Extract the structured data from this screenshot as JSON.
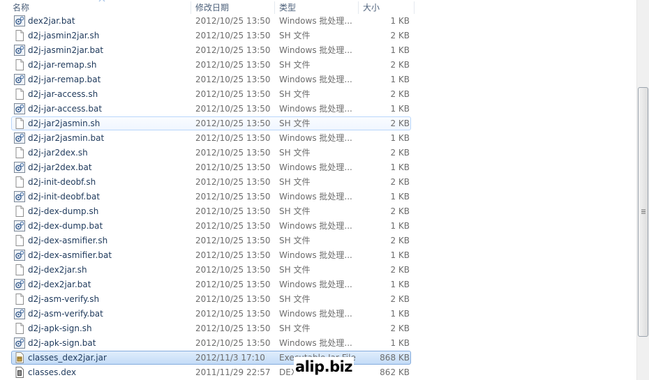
{
  "columns": {
    "name": "名称",
    "date": "修改日期",
    "type": "类型",
    "size": "大小"
  },
  "files": [
    {
      "name": "dex2jar.bat",
      "date": "2012/10/25 13:50",
      "type": "Windows 批处理...",
      "size": "1 KB",
      "icon": "batch-file-icon"
    },
    {
      "name": "d2j-jasmin2jar.sh",
      "date": "2012/10/25 13:50",
      "type": "SH 文件",
      "size": "2 KB",
      "icon": "blank-file-icon"
    },
    {
      "name": "d2j-jasmin2jar.bat",
      "date": "2012/10/25 13:50",
      "type": "Windows 批处理...",
      "size": "1 KB",
      "icon": "batch-file-icon"
    },
    {
      "name": "d2j-jar-remap.sh",
      "date": "2012/10/25 13:50",
      "type": "SH 文件",
      "size": "2 KB",
      "icon": "blank-file-icon"
    },
    {
      "name": "d2j-jar-remap.bat",
      "date": "2012/10/25 13:50",
      "type": "Windows 批处理...",
      "size": "1 KB",
      "icon": "batch-file-icon"
    },
    {
      "name": "d2j-jar-access.sh",
      "date": "2012/10/25 13:50",
      "type": "SH 文件",
      "size": "2 KB",
      "icon": "blank-file-icon"
    },
    {
      "name": "d2j-jar-access.bat",
      "date": "2012/10/25 13:50",
      "type": "Windows 批处理...",
      "size": "1 KB",
      "icon": "batch-file-icon"
    },
    {
      "name": "d2j-jar2jasmin.sh",
      "date": "2012/10/25 13:50",
      "type": "SH 文件",
      "size": "2 KB",
      "icon": "blank-file-icon",
      "state": "hover"
    },
    {
      "name": "d2j-jar2jasmin.bat",
      "date": "2012/10/25 13:50",
      "type": "Windows 批处理...",
      "size": "1 KB",
      "icon": "batch-file-icon"
    },
    {
      "name": "d2j-jar2dex.sh",
      "date": "2012/10/25 13:50",
      "type": "SH 文件",
      "size": "2 KB",
      "icon": "blank-file-icon"
    },
    {
      "name": "d2j-jar2dex.bat",
      "date": "2012/10/25 13:50",
      "type": "Windows 批处理...",
      "size": "1 KB",
      "icon": "batch-file-icon"
    },
    {
      "name": "d2j-init-deobf.sh",
      "date": "2012/10/25 13:50",
      "type": "SH 文件",
      "size": "2 KB",
      "icon": "blank-file-icon"
    },
    {
      "name": "d2j-init-deobf.bat",
      "date": "2012/10/25 13:50",
      "type": "Windows 批处理...",
      "size": "1 KB",
      "icon": "batch-file-icon"
    },
    {
      "name": "d2j-dex-dump.sh",
      "date": "2012/10/25 13:50",
      "type": "SH 文件",
      "size": "2 KB",
      "icon": "blank-file-icon"
    },
    {
      "name": "d2j-dex-dump.bat",
      "date": "2012/10/25 13:50",
      "type": "Windows 批处理...",
      "size": "1 KB",
      "icon": "batch-file-icon"
    },
    {
      "name": "d2j-dex-asmifier.sh",
      "date": "2012/10/25 13:50",
      "type": "SH 文件",
      "size": "2 KB",
      "icon": "blank-file-icon"
    },
    {
      "name": "d2j-dex-asmifier.bat",
      "date": "2012/10/25 13:50",
      "type": "Windows 批处理...",
      "size": "1 KB",
      "icon": "batch-file-icon"
    },
    {
      "name": "d2j-dex2jar.sh",
      "date": "2012/10/25 13:50",
      "type": "SH 文件",
      "size": "2 KB",
      "icon": "blank-file-icon"
    },
    {
      "name": "d2j-dex2jar.bat",
      "date": "2012/10/25 13:50",
      "type": "Windows 批处理...",
      "size": "1 KB",
      "icon": "batch-file-icon"
    },
    {
      "name": "d2j-asm-verify.sh",
      "date": "2012/10/25 13:50",
      "type": "SH 文件",
      "size": "2 KB",
      "icon": "blank-file-icon"
    },
    {
      "name": "d2j-asm-verify.bat",
      "date": "2012/10/25 13:50",
      "type": "Windows 批处理...",
      "size": "1 KB",
      "icon": "batch-file-icon"
    },
    {
      "name": "d2j-apk-sign.sh",
      "date": "2012/10/25 13:50",
      "type": "SH 文件",
      "size": "2 KB",
      "icon": "blank-file-icon"
    },
    {
      "name": "d2j-apk-sign.bat",
      "date": "2012/10/25 13:50",
      "type": "Windows 批处理...",
      "size": "1 KB",
      "icon": "batch-file-icon"
    },
    {
      "name": "classes_dex2jar.jar",
      "date": "2012/11/3 17:10",
      "type": "Executable Jar File",
      "size": "868 KB",
      "icon": "jar-file-icon",
      "state": "selected"
    },
    {
      "name": "classes.dex",
      "date": "2011/11/29 22:57",
      "type": "DEX 文件",
      "size": "862 KB",
      "icon": "dex-file-icon"
    }
  ],
  "watermark": "alip.biz",
  "colors": {
    "selection_border": "#84acdd",
    "hover_border": "#b8d6fb",
    "name_text": "#1e395b",
    "detail_text": "#6d6d6d"
  }
}
